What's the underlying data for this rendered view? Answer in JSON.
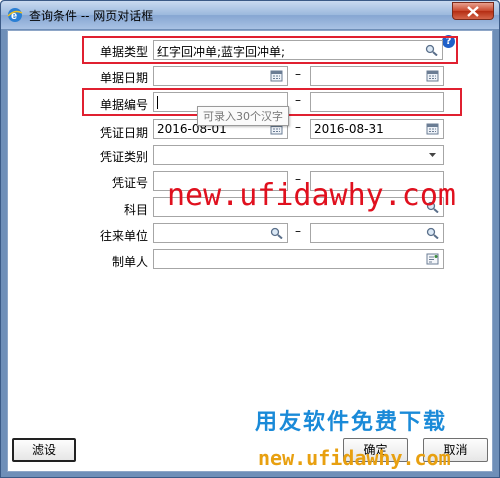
{
  "window": {
    "title": "查询条件 -- 网页对话框",
    "help": "?"
  },
  "form": {
    "doc_type": {
      "label": "单据类型",
      "value": "红字回冲单;蓝字回冲单;"
    },
    "doc_date": {
      "label": "单据日期",
      "from": "",
      "to": ""
    },
    "doc_number": {
      "label": "单据编号",
      "from": "",
      "to": "",
      "tooltip": "可录入30个汉字"
    },
    "voucher_date": {
      "label": "凭证日期",
      "from": "2016-08-01",
      "to": "2016-08-31"
    },
    "voucher_category": {
      "label": "凭证类别",
      "value": ""
    },
    "voucher_number": {
      "label": "凭证号",
      "from": "",
      "to": ""
    },
    "subject": {
      "label": "科目",
      "value": ""
    },
    "partner": {
      "label": "往来单位",
      "from": "",
      "to": ""
    },
    "creator": {
      "label": "制单人",
      "value": ""
    },
    "range_separator": "–"
  },
  "buttons": {
    "filter": "滤设",
    "ok": "确定",
    "cancel": "取消"
  },
  "watermarks": {
    "top": "new.ufidawhy.com",
    "bottom_cn": "用友软件免费下载",
    "bottom_url": "new.ufidawhy.com"
  },
  "colors": {
    "highlight_box": "#e02030",
    "watermark_red": "#e0101e",
    "watermark_blue": "#1a8ad8",
    "watermark_orange": "#e8a010",
    "titlebar": "#9bb8dd"
  },
  "icons": [
    "ie-icon",
    "close-icon",
    "search-icon",
    "calendar-icon",
    "dropdown-arrow-icon",
    "help-icon",
    "user-select-icon"
  ]
}
